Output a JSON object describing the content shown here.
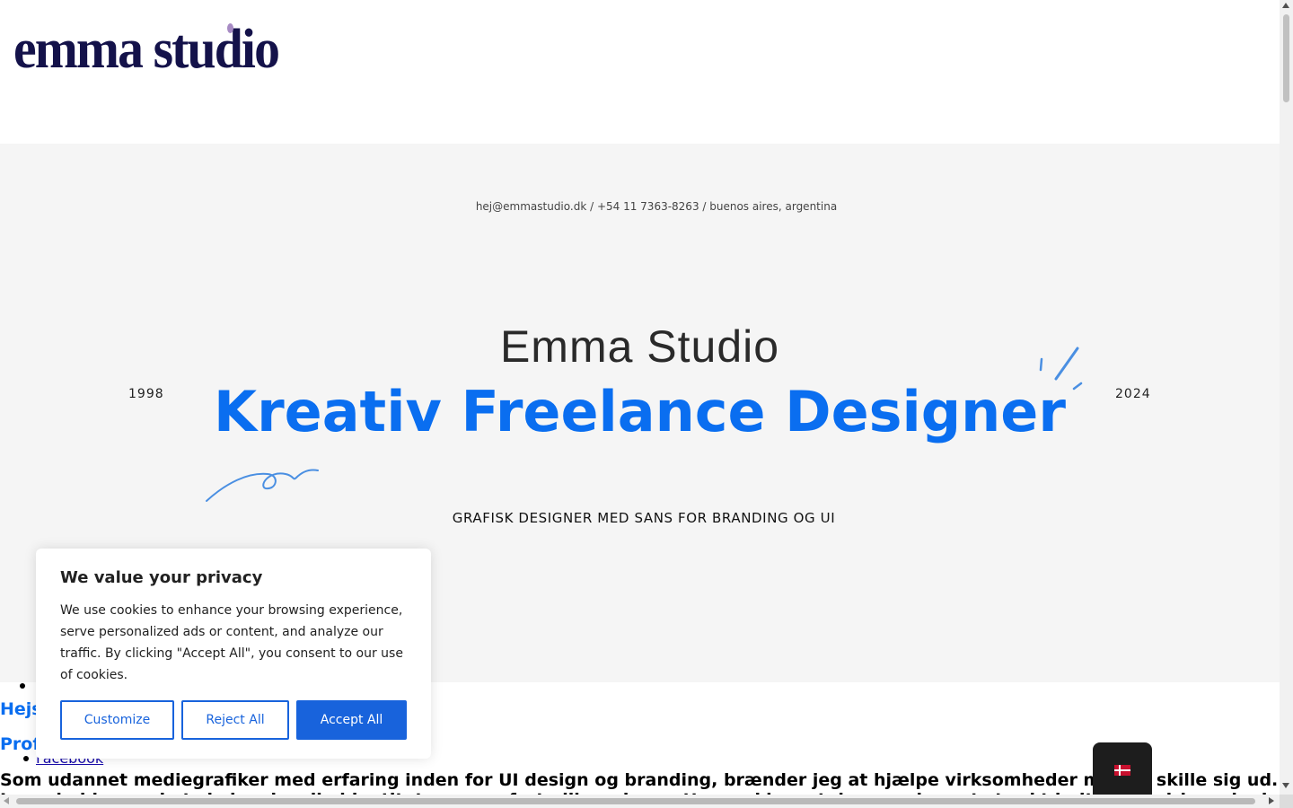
{
  "header": {
    "logo_text": "emma studio"
  },
  "hero": {
    "contact_line": "hej@emmastudio.dk / +54 11 7363-8263 / buenos aires, argentina",
    "title": "Emma Studio",
    "headline": "Kreativ Freelance Designer",
    "year_start": "1998",
    "year_end": "2024",
    "tagline": "GRAFISK DESIGNER MED SANS FOR BRANDING OG UI"
  },
  "content": {
    "heading_1": "Hejs",
    "heading_2": "Prof",
    "social_link": "Facebook",
    "paragraph": "Som udannet mediegrafiker med erfaring inden for UI design og branding, brænder jeg at hjælpe virksomheder med at skille sig ud.",
    "paragraph_2": "Jeg arbejder med at skabe visuelle identiteter og en fortælling, der sætter en klar retning og giver et stærkt indtryk af virksomheden og dens værdier"
  },
  "cookie_banner": {
    "title": "We value your privacy",
    "text": "We use cookies to enhance your browsing experience, serve personalized ads or content, and analyze our traffic. By clicking \"Accept All\", you consent to our use of cookies.",
    "customize_label": "Customize",
    "reject_label": "Reject All",
    "accept_label": "Accept All"
  },
  "language_switcher": {
    "flag_icon": "denmark-flag-icon"
  },
  "colors": {
    "accent": "#0a6ef0",
    "logo": "#14124a",
    "cookie_button": "#1863dc",
    "hero_bg": "#f5f5f5"
  }
}
